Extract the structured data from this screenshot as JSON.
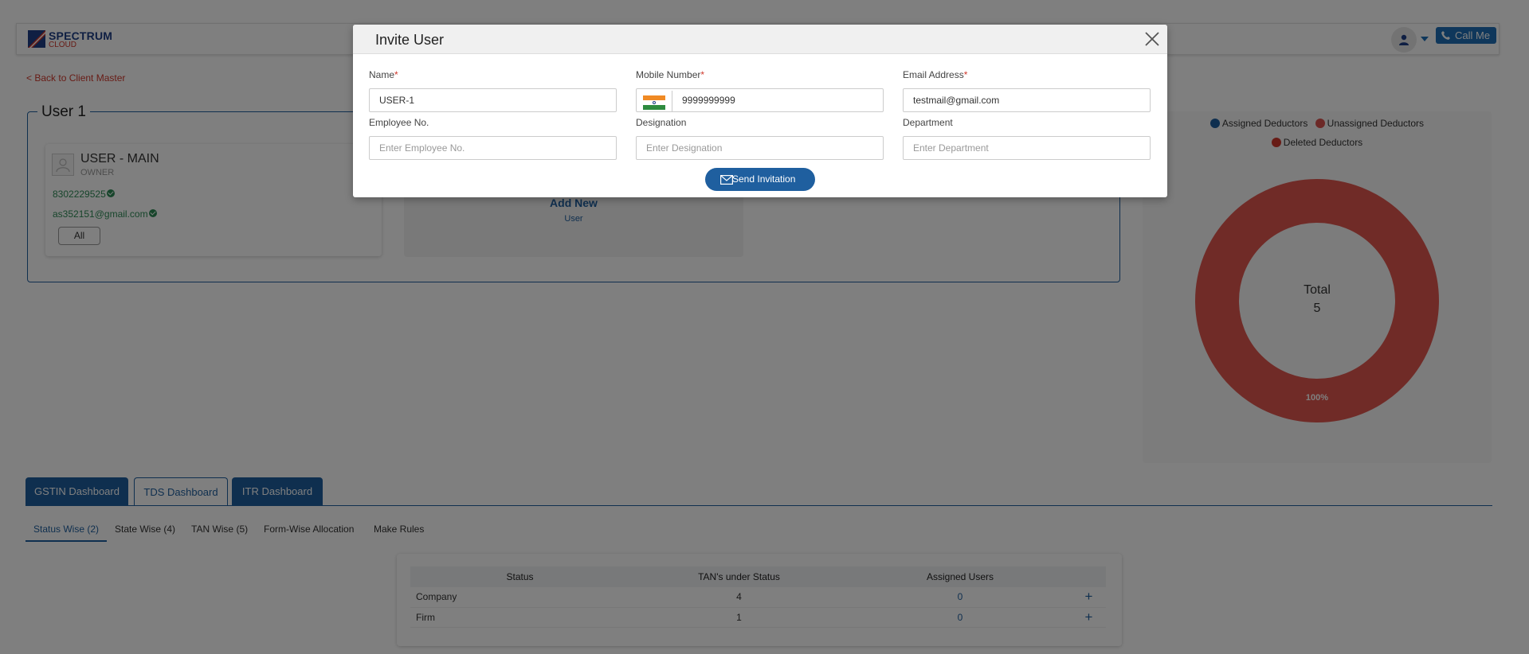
{
  "header": {
    "logo_main": "SPECTRUM",
    "logo_sub": "CLOUD",
    "call_me": "Call Me"
  },
  "page": {
    "back_link": "< Back to Client Master",
    "panel_title": "User 1",
    "user_card": {
      "name": "USER - MAIN",
      "role": "OWNER",
      "phone": "8302229525",
      "email": "as352151@gmail.com",
      "filter_button": "All"
    },
    "add_new": {
      "title": "Add New",
      "subtitle": "User"
    }
  },
  "chart_data": {
    "type": "pie",
    "legend": [
      "Assigned Deductors",
      "Unassigned Deductors",
      "Deleted Deductors"
    ],
    "legend_colors": [
      "#1f5f9f",
      "#d9534f",
      "#d0392d"
    ],
    "categories": [
      "Assigned Deductors",
      "Unassigned Deductors",
      "Deleted Deductors"
    ],
    "values": [
      0,
      5,
      0
    ],
    "center_label": "Total",
    "center_value": "5",
    "slice_label": "100%",
    "slice_color": "#e0574f"
  },
  "tabs": [
    {
      "label": "GSTIN Dashboard",
      "active": false
    },
    {
      "label": "TDS Dashboard",
      "active": true
    },
    {
      "label": "ITR Dashboard",
      "active": false
    }
  ],
  "subtabs": [
    {
      "label": "Status Wise (2)",
      "active": true
    },
    {
      "label": "State Wise (4)",
      "active": false
    },
    {
      "label": "TAN Wise (5)",
      "active": false
    },
    {
      "label": "Form-Wise Allocation",
      "active": false
    },
    {
      "label": "Make Rules",
      "active": false
    }
  ],
  "status_table": {
    "headers": [
      "Status",
      "TAN's under Status",
      "Assigned Users",
      ""
    ],
    "rows": [
      {
        "status": "Company",
        "tans": "4",
        "assigned": "0",
        "action": "+"
      },
      {
        "status": "Firm",
        "tans": "1",
        "assigned": "0",
        "action": "+"
      }
    ]
  },
  "modal": {
    "title": "Invite User",
    "fields": {
      "name": {
        "label": "Name",
        "required": "*",
        "value": "USER-1"
      },
      "mobile": {
        "label": "Mobile Number",
        "required": "*",
        "value": "9999999999"
      },
      "email": {
        "label": "Email Address",
        "required": "*",
        "value": "testmail@gmail.com"
      },
      "employee_no": {
        "label": "Employee No.",
        "placeholder": "Enter Employee No."
      },
      "designation": {
        "label": "Designation",
        "placeholder": "Enter Designation"
      },
      "department": {
        "label": "Department",
        "placeholder": "Enter Department"
      }
    },
    "send_button": "Send Invitation"
  }
}
